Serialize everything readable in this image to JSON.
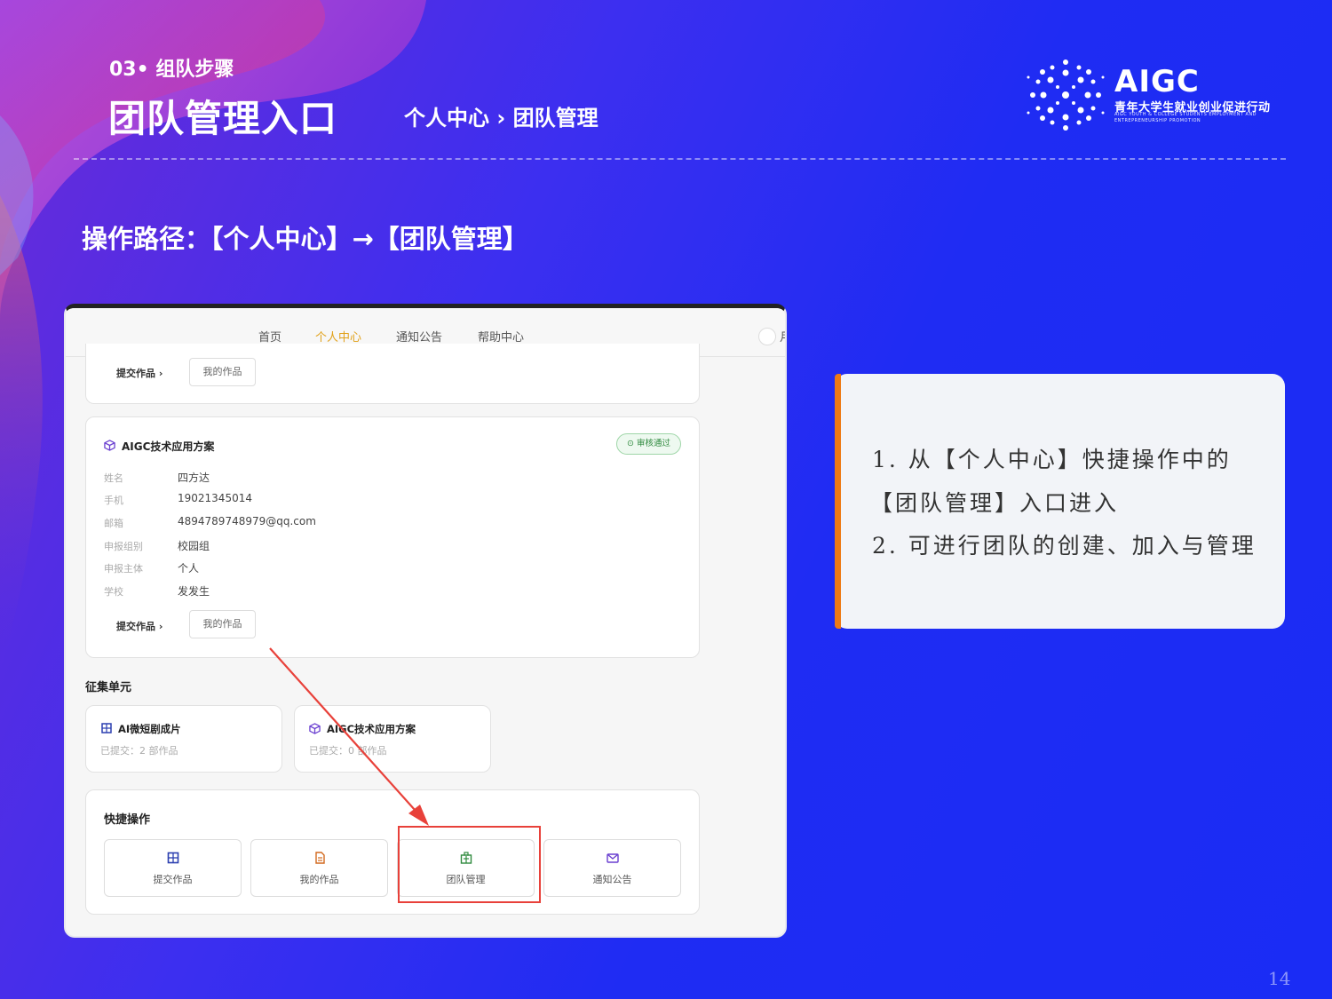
{
  "header": {
    "section_label": "03• 组队步骤",
    "title": "团队管理入口",
    "path": "个人中心 › 团队管理"
  },
  "logo": {
    "name": "AIGC",
    "subtitle": "青年大学生就业创业促进行动",
    "english": "AIGC YOUTH & COLLEGE STUDENTS EMPLOYMENT AND ENTREPRENEURSHIP PROMOTION"
  },
  "operation_path": "操作路径：【个人中心】→【团队管理】",
  "screenshot": {
    "nav": [
      "首页",
      "个人中心",
      "通知公告",
      "帮助中心"
    ],
    "nav_clipped": "月",
    "top_card": {
      "submit_label": "提交作品 ›",
      "my_works_label": "我的作品"
    },
    "project_card": {
      "title": "AIGC技术应用方案",
      "badge": "审核通过",
      "fields": [
        {
          "label": "姓名",
          "value": "四方达"
        },
        {
          "label": "手机",
          "value": "19021345014"
        },
        {
          "label": "邮箱",
          "value": "4894789748979@qq.com"
        },
        {
          "label": "申报组别",
          "value": "校园组"
        },
        {
          "label": "申报主体",
          "value": "个人"
        },
        {
          "label": "学校",
          "value": "发发生"
        }
      ],
      "submit_label": "提交作品 ›",
      "my_works_label": "我的作品"
    },
    "units_heading": "征集单元",
    "units": [
      {
        "title": "AI微短剧成片",
        "sub": "已提交：2 部作品"
      },
      {
        "title": "AIGC技术应用方案",
        "sub": "已提交：0 部作品"
      }
    ],
    "quick_heading": "快捷操作",
    "quick_actions": [
      {
        "label": "提交作品",
        "icon": "film-icon"
      },
      {
        "label": "我的作品",
        "icon": "document-icon"
      },
      {
        "label": "团队管理",
        "icon": "team-icon"
      },
      {
        "label": "通知公告",
        "icon": "mail-icon"
      }
    ]
  },
  "note": {
    "line1": "1. 从【个人中心】快捷操作中的",
    "line2": "【团队管理】入口进入",
    "line3": "2. 可进行团队的创建、加入与管理"
  },
  "page_number": "14",
  "colors": {
    "accent_orange": "#ee7a14",
    "highlight_red": "#e8413a",
    "nav_active": "#e1a11a",
    "bg_blue": "#1a2cf5"
  }
}
